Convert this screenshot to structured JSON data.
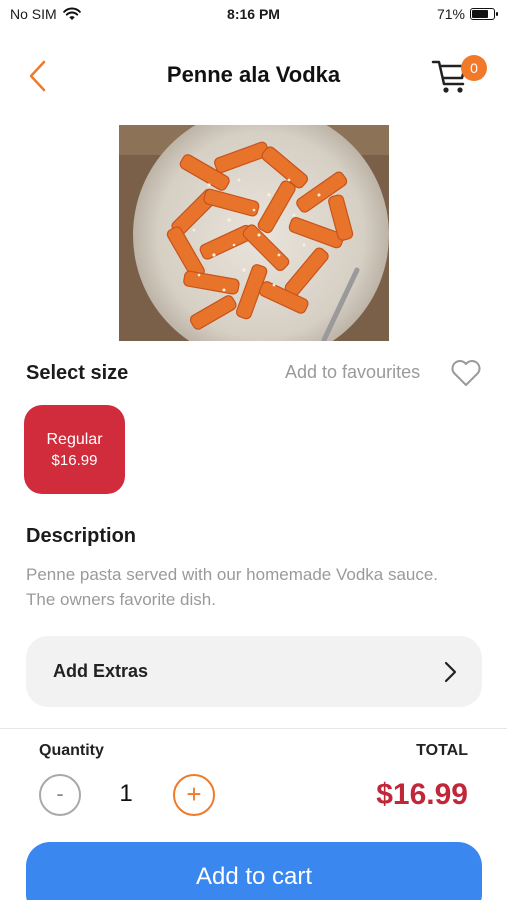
{
  "status_bar": {
    "carrier": "No SIM",
    "time": "8:16 PM",
    "battery_percent_label": "71%",
    "battery_level": 0.71,
    "wifi_icon": "wifi-icon"
  },
  "nav": {
    "title": "Penne ala Vodka",
    "cart_count": "0",
    "accent_color": "#f07a2a"
  },
  "size_section": {
    "heading": "Select size",
    "favourites_label": "Add to favourites",
    "options": [
      {
        "name": "Regular",
        "price": "$16.99",
        "selected": true
      }
    ],
    "selected_color": "#d02c3b"
  },
  "description": {
    "heading": "Description",
    "text": "Penne pasta served with our homemade Vodka sauce. The owners favorite dish."
  },
  "extras": {
    "label": "Add Extras"
  },
  "order": {
    "quantity_label": "Quantity",
    "total_label": "TOTAL",
    "decrement_symbol": "-",
    "increment_symbol": "+",
    "quantity": "1",
    "total": "$16.99",
    "total_color": "#c0283a"
  },
  "cta": {
    "label": "Add to cart",
    "color": "#3b87f0"
  }
}
